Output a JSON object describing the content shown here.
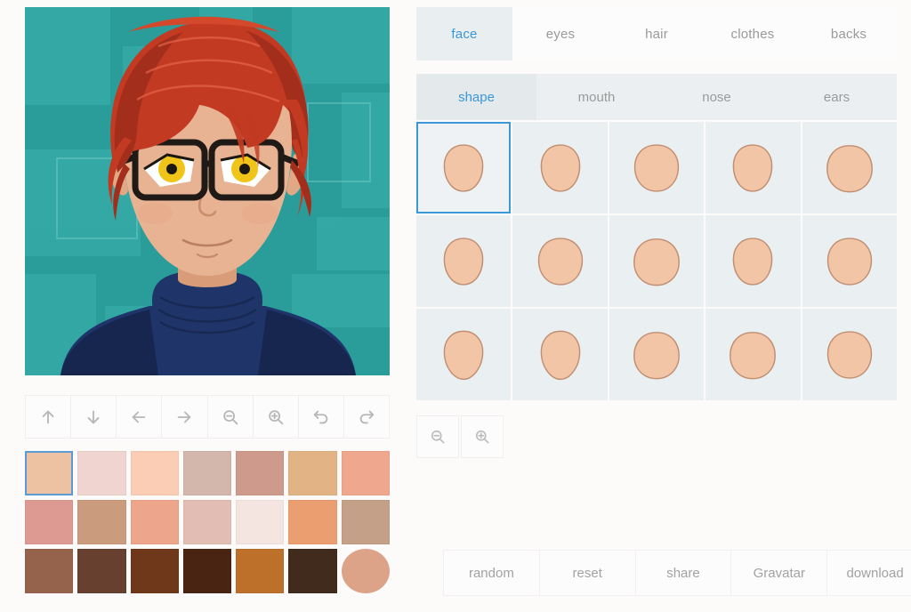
{
  "preview": {
    "label": "avatar-preview",
    "background_color": "#2a9d9b",
    "background_block_color": "#35aaa6",
    "hair_color": "#c23a22",
    "hair_shadow": "#a32e1b",
    "skin_color": "#e8b392",
    "skin_shadow": "#d89c79",
    "eye_color": "#f0c419",
    "glasses_color": "#201a17",
    "clothes_color": "#1f3468",
    "clothes_shadow": "#16264f"
  },
  "toolbar": {
    "buttons": [
      {
        "name": "move-up-button",
        "icon": "arrow-up-icon"
      },
      {
        "name": "move-down-button",
        "icon": "arrow-down-icon"
      },
      {
        "name": "move-left-button",
        "icon": "arrow-left-icon"
      },
      {
        "name": "move-right-button",
        "icon": "arrow-right-icon"
      },
      {
        "name": "zoom-out-button",
        "icon": "magnifier-minus-icon"
      },
      {
        "name": "zoom-in-button",
        "icon": "magnifier-plus-icon"
      },
      {
        "name": "undo-button",
        "icon": "undo-icon"
      },
      {
        "name": "redo-button",
        "icon": "redo-icon"
      }
    ]
  },
  "palette": {
    "selected_index": 0,
    "rows": [
      [
        "#edc2a3",
        "#efd4d0",
        "#fbcdb4",
        "#d3b6ac",
        "#cd9a8b",
        "#e2b384",
        "#efa78e"
      ],
      [
        "#dd9a93",
        "#cb9b7d",
        "#eda68c",
        "#e2bdb3",
        "#f4e5e1",
        "#eb9f71",
        "#c4a088"
      ],
      [
        "#95634c",
        "#67402f",
        "#70381a",
        "#4a2412",
        "#bd702a",
        "#412b1c",
        "#dda389"
      ]
    ],
    "preview_swatch_color": "#dda389"
  },
  "main_tabs": {
    "active": "face",
    "items": [
      {
        "label": "face",
        "name": "tab-face"
      },
      {
        "label": "eyes",
        "name": "tab-eyes"
      },
      {
        "label": "hair",
        "name": "tab-hair"
      },
      {
        "label": "clothes",
        "name": "tab-clothes"
      },
      {
        "label": "backs",
        "name": "tab-backs"
      }
    ]
  },
  "sub_tabs": {
    "active": "shape",
    "items": [
      {
        "label": "shape",
        "name": "subtab-shape"
      },
      {
        "label": "mouth",
        "name": "subtab-mouth"
      },
      {
        "label": "nose",
        "name": "subtab-nose"
      },
      {
        "label": "ears",
        "name": "subtab-ears"
      }
    ]
  },
  "shape_grid": {
    "columns": 5,
    "rows": 3,
    "selected_index": 0,
    "item_fill": "#f3c5a7",
    "item_stroke": "#c08f72",
    "items": [
      {
        "name": "shape-option-1",
        "variant": "egg-narrow"
      },
      {
        "name": "shape-option-2",
        "variant": "egg-narrow"
      },
      {
        "name": "shape-option-3",
        "variant": "egg-wide"
      },
      {
        "name": "shape-option-4",
        "variant": "egg-narrow"
      },
      {
        "name": "shape-option-5",
        "variant": "egg-round"
      },
      {
        "name": "shape-option-6",
        "variant": "egg-narrow"
      },
      {
        "name": "shape-option-7",
        "variant": "egg-wide"
      },
      {
        "name": "shape-option-8",
        "variant": "egg-round"
      },
      {
        "name": "shape-option-9",
        "variant": "egg-narrow"
      },
      {
        "name": "shape-option-10",
        "variant": "egg-wide"
      },
      {
        "name": "shape-option-11",
        "variant": "egg-pointed"
      },
      {
        "name": "shape-option-12",
        "variant": "egg-pointed"
      },
      {
        "name": "shape-option-13",
        "variant": "egg-round"
      },
      {
        "name": "shape-option-14",
        "variant": "egg-round"
      },
      {
        "name": "shape-option-15",
        "variant": "egg-wide"
      }
    ]
  },
  "grid_zoom": {
    "buttons": [
      {
        "name": "grid-zoom-out-button",
        "icon": "magnifier-minus-icon"
      },
      {
        "name": "grid-zoom-in-button",
        "icon": "magnifier-plus-icon"
      }
    ]
  },
  "actions": {
    "items": [
      {
        "label": "random",
        "name": "random-button"
      },
      {
        "label": "reset",
        "name": "reset-button"
      },
      {
        "label": "share",
        "name": "share-button"
      },
      {
        "label": "Gravatar",
        "name": "gravatar-button"
      },
      {
        "label": "download",
        "name": "download-button"
      }
    ]
  },
  "colors": {
    "accent": "#3b98d8",
    "page_background": "#fdfafa",
    "cell_background": "#eaeff1",
    "muted_text": "#9a9a9a"
  }
}
